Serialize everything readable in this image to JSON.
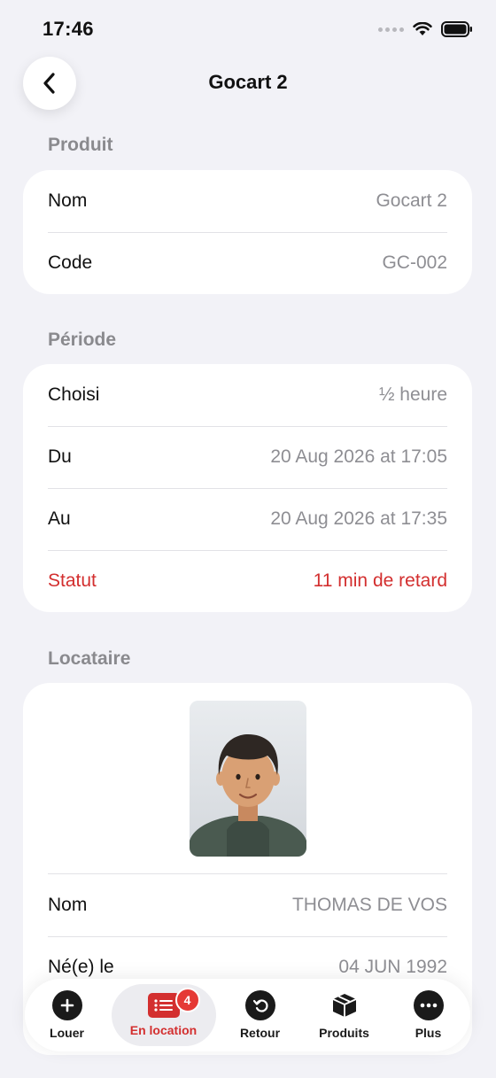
{
  "status_bar": {
    "time": "17:46"
  },
  "header": {
    "title": "Gocart 2",
    "back_icon": "chevron-left-icon"
  },
  "sections": {
    "produit": {
      "title": "Produit",
      "rows": [
        {
          "label": "Nom",
          "value": "Gocart 2"
        },
        {
          "label": "Code",
          "value": "GC-002"
        }
      ]
    },
    "periode": {
      "title": "Période",
      "rows": [
        {
          "label": "Choisi",
          "value": "½ heure"
        },
        {
          "label": "Du",
          "value": "20 Aug 2026 at 17:05"
        },
        {
          "label": "Au",
          "value": "20 Aug 2026 at 17:35"
        },
        {
          "label": "Statut",
          "value": "11 min de retard",
          "color": "#d32f2f"
        }
      ]
    },
    "locataire": {
      "title": "Locataire",
      "photo_icon": "person-avatar",
      "rows": [
        {
          "label": "Nom",
          "value": "THOMAS DE VOS"
        },
        {
          "label": "Né(e) le",
          "value": "04 JUN 1992"
        }
      ]
    }
  },
  "tabbar": {
    "tabs": [
      {
        "label": "Louer",
        "icon": "plus-circle-icon"
      },
      {
        "label": "En location",
        "icon": "list-icon",
        "badge": "4",
        "active": true
      },
      {
        "label": "Retour",
        "icon": "return-arrow-icon"
      },
      {
        "label": "Produits",
        "icon": "box-icon"
      },
      {
        "label": "Plus",
        "icon": "ellipsis-circle-icon"
      }
    ]
  },
  "colors": {
    "accent": "#d32f2f",
    "background": "#f2f2f7"
  }
}
